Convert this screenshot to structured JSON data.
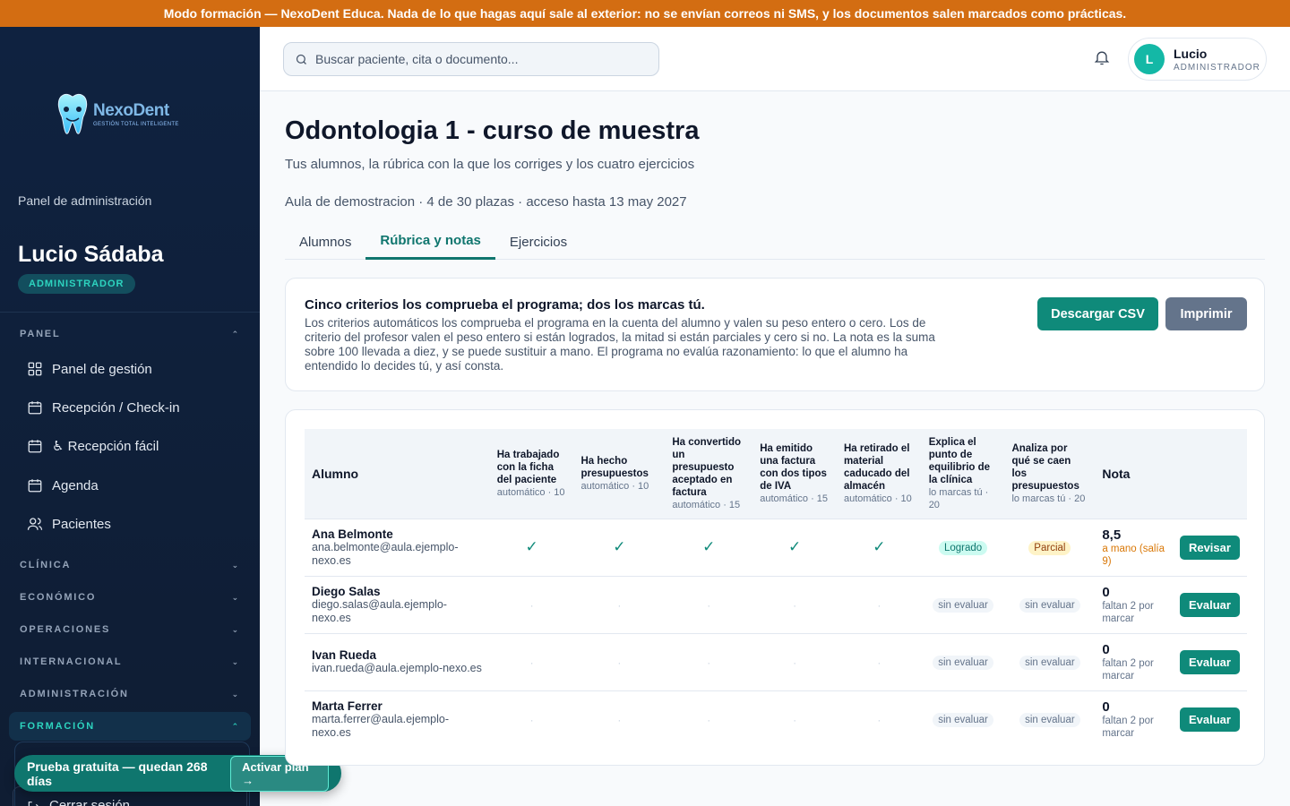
{
  "banner": {
    "text": "Modo formación — NexoDent Educa. Nada de lo que hagas aquí sale al exterior: no se envían correos ni SMS, y los documentos salen marcados como prácticas."
  },
  "sidebar": {
    "logo_text": "NexoDent",
    "logo_tagline": "GESTIÓN TOTAL INTELIGENTE",
    "panel_label": "Panel de administración",
    "user_name": "Lucio Sádaba",
    "user_role": "ADMINISTRADOR",
    "groups": [
      {
        "label": "PANEL",
        "expanded": true
      },
      {
        "label": "CLÍNICA",
        "expanded": false
      },
      {
        "label": "ECONÓMICO",
        "expanded": false
      },
      {
        "label": "OPERACIONES",
        "expanded": false
      },
      {
        "label": "INTERNACIONAL",
        "expanded": false
      },
      {
        "label": "ADMINISTRACIÓN",
        "expanded": false
      },
      {
        "label": "FORMACIÓN",
        "expanded": true,
        "active": true
      }
    ],
    "panel_items": [
      {
        "label": "Panel de gestión",
        "icon": "grid-icon"
      },
      {
        "label": "Recepción / Check-in",
        "icon": "calendar-icon"
      },
      {
        "label": "♿ Recepción fácil",
        "icon": "calendar-icon"
      },
      {
        "label": "Agenda",
        "icon": "calendar-icon"
      },
      {
        "label": "Pacientes",
        "icon": "users-icon"
      }
    ],
    "logout_label": "Cerrar sesión"
  },
  "trial": {
    "text": "Prueba gratuita — quedan 268 días",
    "button": "Activar plan →"
  },
  "topbar": {
    "search_placeholder": "Buscar paciente, cita o documento...",
    "user_initial": "L",
    "user_name": "Lucio",
    "user_role": "ADMINISTRADOR"
  },
  "page": {
    "title": "Odontologia 1 - curso de muestra",
    "subtitle": "Tus alumnos, la rúbrica con la que los corriges y los cuatro ejercicios",
    "meta": "Aula de demostracion · 4 de 30 plazas · acceso hasta 13 may 2027",
    "tabs": [
      "Alumnos",
      "Rúbrica y notas",
      "Ejercicios"
    ],
    "active_tab": 1
  },
  "info": {
    "title": "Cinco criterios los comprueba el programa; dos los marcas tú.",
    "text": "Los criterios automáticos los comprueba el programa en la cuenta del alumno y valen su peso entero o cero. Los de criterio del profesor valen el peso entero si están logrados, la mitad si están parciales y cero si no. La nota es la suma sobre 100 llevada a diez, y se puede sustituir a mano. El programa no evalúa razonamiento: lo que el alumno ha entendido lo decides tú, y así consta.",
    "csv_button": "Descargar CSV",
    "print_button": "Imprimir"
  },
  "table": {
    "student_header": "Alumno",
    "grade_header": "Nota",
    "criteria": [
      {
        "label": "Ha trabajado con la ficha del paciente",
        "sub": "automático · 10"
      },
      {
        "label": "Ha hecho presupuestos",
        "sub": "automático · 10"
      },
      {
        "label": "Ha convertido un presupuesto aceptado en factura",
        "sub": "automático · 15"
      },
      {
        "label": "Ha emitido una factura con dos tipos de IVA",
        "sub": "automático · 15"
      },
      {
        "label": "Ha retirado el material caducado del almacén",
        "sub": "automático · 10"
      },
      {
        "label": "Explica el punto de equilibrio de la clínica",
        "sub": "lo marcas tú · 20"
      },
      {
        "label": "Analiza por qué se caen los presupuestos",
        "sub": "lo marcas tú · 20"
      }
    ],
    "rows": [
      {
        "name": "Ana Belmonte",
        "email": "ana.belmonte@aula.ejemplo-nexo.es",
        "auto": [
          "✓",
          "✓",
          "✓",
          "✓",
          "✓"
        ],
        "manual": [
          "Logrado",
          "Parcial"
        ],
        "manual_types": [
          "ok",
          "part"
        ],
        "grade": "8,5",
        "grade_note": "a mano (salía 9)",
        "action": "Revisar"
      },
      {
        "name": "Diego Salas",
        "email": "diego.salas@aula.ejemplo-nexo.es",
        "auto": [
          "·",
          "·",
          "·",
          "·",
          "·"
        ],
        "manual": [
          "sin evaluar",
          "sin evaluar"
        ],
        "manual_types": [
          "none",
          "none"
        ],
        "grade": "0",
        "grade_missing": "faltan 2 por marcar",
        "action": "Evaluar"
      },
      {
        "name": "Ivan Rueda",
        "email": "ivan.rueda@aula.ejemplo-nexo.es",
        "auto": [
          "·",
          "·",
          "·",
          "·",
          "·"
        ],
        "manual": [
          "sin evaluar",
          "sin evaluar"
        ],
        "manual_types": [
          "none",
          "none"
        ],
        "grade": "0",
        "grade_missing": "faltan 2 por marcar",
        "action": "Evaluar"
      },
      {
        "name": "Marta Ferrer",
        "email": "marta.ferrer@aula.ejemplo-nexo.es",
        "auto": [
          "·",
          "·",
          "·",
          "·",
          "·"
        ],
        "manual": [
          "sin evaluar",
          "sin evaluar"
        ],
        "manual_types": [
          "none",
          "none"
        ],
        "grade": "0",
        "grade_missing": "faltan 2 por marcar",
        "action": "Evaluar"
      }
    ]
  },
  "colors": {
    "accent": "#0f8a7a",
    "banner": "#d36d12",
    "sidebar": "#0f2240"
  }
}
